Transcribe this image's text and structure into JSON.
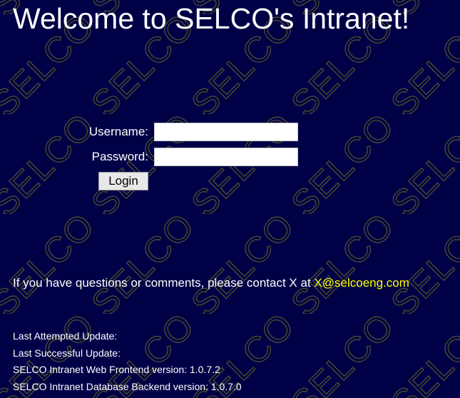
{
  "page": {
    "title": "Welcome to SELCO's Intranet!",
    "watermark_text": "SELCO",
    "background_color": "#000046",
    "text_color": "#ffffff",
    "link_color": "#ffff00"
  },
  "login": {
    "username_label": "Username:",
    "username_value": "",
    "password_label": "Password:",
    "password_value": "",
    "button_label": "Login"
  },
  "contact": {
    "text": "If you have questions or comments, please contact X at",
    "email": "X@selcoeng.com"
  },
  "status": {
    "last_attempted_update": "Last Attempted Update:",
    "last_successful_update": "Last Successful Update:",
    "frontend_version": "SELCO Intranet Web Frontend version: 1.0.7.2",
    "backend_version": "SELCO Intranet Database Backend version: 1.0.7.0"
  }
}
